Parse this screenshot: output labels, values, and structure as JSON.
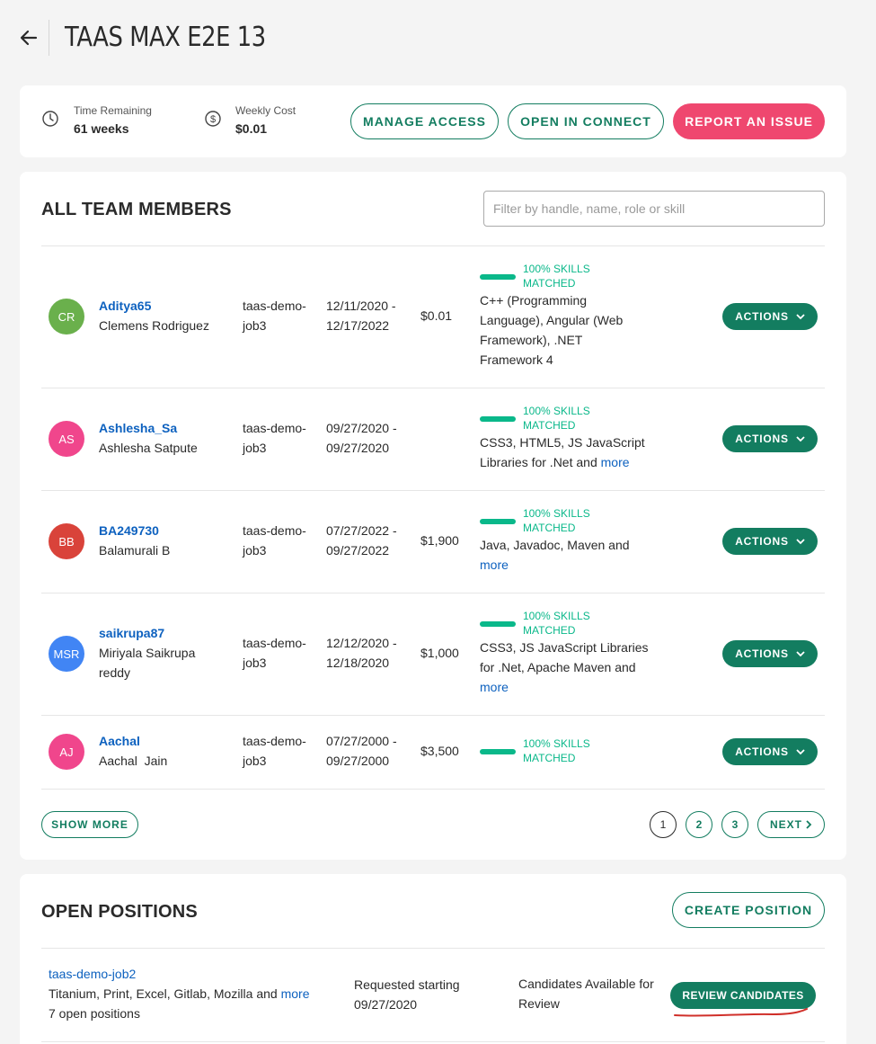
{
  "header": {
    "title": "TAAS MAX E2E 13"
  },
  "summary": {
    "time_remaining_label": "Time Remaining",
    "time_remaining_value": "61 weeks",
    "weekly_cost_label": "Weekly Cost",
    "weekly_cost_value": "$0.01",
    "manage_access": "MANAGE ACCESS",
    "open_in_connect": "OPEN IN CONNECT",
    "report_issue": "REPORT AN ISSUE"
  },
  "team": {
    "title": "ALL TEAM MEMBERS",
    "filter_placeholder": "Filter by handle, name, role or skill",
    "members": [
      {
        "initials": "CR",
        "avatar_color": "#6ab04c",
        "handle": "Aditya65",
        "name": "Clemens Rodriguez",
        "job_line1": "taas-demo-",
        "job_line2": "job3",
        "date_start": "12/11/2020 -",
        "date_end": "12/17/2022",
        "rate": "$0.01",
        "skills_pct_line1": "100% SKILLS",
        "skills_pct_line2": "MATCHED",
        "skills": [
          "C++ (Programming",
          "Language), Angular (Web",
          "Framework), .NET",
          "Framework 4"
        ],
        "more": ""
      },
      {
        "initials": "AS",
        "avatar_color": "#f0468c",
        "handle": "Ashlesha_Sa",
        "name": "Ashlesha Satpute",
        "job_line1": "taas-demo-",
        "job_line2": "job3",
        "date_start": "09/27/2020 -",
        "date_end": "09/27/2020",
        "rate": "",
        "skills_pct_line1": "100% SKILLS",
        "skills_pct_line2": "MATCHED",
        "skills": [
          "CSS3, HTML5, JS JavaScript",
          "Libraries for .Net and"
        ],
        "more": "more"
      },
      {
        "initials": "BB",
        "avatar_color": "#d9433a",
        "handle": "BA249730",
        "name": "Balamurali B",
        "job_line1": "taas-demo-",
        "job_line2": "job3",
        "date_start": "07/27/2022 -",
        "date_end": "09/27/2022",
        "rate": "$1,900",
        "skills_pct_line1": "100% SKILLS",
        "skills_pct_line2": "MATCHED",
        "skills": [
          "Java, Javadoc, Maven and"
        ],
        "more": "more"
      },
      {
        "initials": "MSR",
        "avatar_color": "#4185f4",
        "handle": "saikrupa87",
        "name_line1": "Miriyala Saikrupa",
        "name_line2": "reddy",
        "job_line1": "taas-demo-",
        "job_line2": "job3",
        "date_start": "12/12/2020 -",
        "date_end": "12/18/2020",
        "rate": "$1,000",
        "skills_pct_line1": "100% SKILLS",
        "skills_pct_line2": "MATCHED",
        "skills": [
          "CSS3, JS JavaScript Libraries",
          "for .Net, Apache Maven and"
        ],
        "more": "more"
      },
      {
        "initials": "AJ",
        "avatar_color": "#f0468c",
        "handle": "Aachal",
        "name": "Aachal  Jain",
        "job_line1": "taas-demo-",
        "job_line2": "job3",
        "date_start": "07/27/2000 -",
        "date_end": "09/27/2000",
        "rate": "$3,500",
        "skills_pct_line1": "100% SKILLS",
        "skills_pct_line2": "MATCHED",
        "skills": [],
        "more": ""
      }
    ],
    "actions_label": "ACTIONS",
    "show_more": "SHOW MORE",
    "pages": [
      "1",
      "2",
      "3"
    ],
    "next": "NEXT"
  },
  "positions": {
    "title": "OPEN POSITIONS",
    "create": "CREATE POSITION",
    "items": [
      {
        "job": "taas-demo-job2",
        "skills": "Titanium, Print, Excel, Gitlab, Mozilla and",
        "more": "more",
        "count": "7 open positions",
        "requested_line1": "Requested starting",
        "requested_line2": "09/27/2020",
        "status_line1": "Candidates Available for",
        "status_line2": "Review",
        "review": "REVIEW CANDIDATES"
      }
    ]
  },
  "colors": {
    "accent": "#137d60",
    "danger": "#ef476f",
    "link": "#0d61bf",
    "skill": "#0ab88a",
    "annotation": "#d0302a"
  }
}
